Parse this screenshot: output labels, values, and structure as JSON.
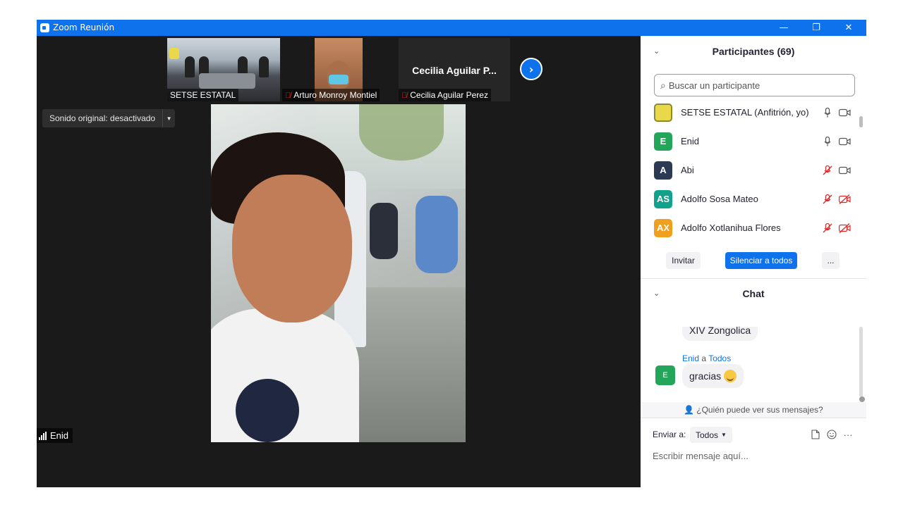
{
  "window": {
    "title": "Zoom Reunión",
    "controls": {
      "minimize": "—",
      "restore": "❐",
      "close": "✕"
    }
  },
  "meeting": {
    "thumbnails": [
      {
        "name": "SETSE ESTATAL",
        "muted": false
      },
      {
        "name": "Arturo Monroy Montiel",
        "muted": true
      },
      {
        "name": "Cecilia Aguilar Perez",
        "muted": true,
        "display_name": "Cecilia  Aguilar  P..."
      }
    ],
    "next_page_icon": "chevron-right-icon",
    "original_sound_label": "Sonido original: desactivado",
    "active_speaker": {
      "name": "Enid"
    }
  },
  "participants": {
    "header": "Participantes (69)",
    "search_placeholder": "Buscar un participante",
    "list": [
      {
        "initials": "",
        "name": "SETSE ESTATAL (Anfitrión, yo)",
        "color": "#e8d84a",
        "mic": "on",
        "video": "on"
      },
      {
        "initials": "E",
        "name": "Enid",
        "color": "#23a55a",
        "mic": "on",
        "video": "on"
      },
      {
        "initials": "A",
        "name": "Abi",
        "color": "#2b3a52",
        "mic": "off",
        "video": "on"
      },
      {
        "initials": "AS",
        "name": "Adolfo Sosa Mateo",
        "color": "#12a28c",
        "mic": "off",
        "video": "off"
      },
      {
        "initials": "AX",
        "name": "Adolfo Xotlanihua Flores",
        "color": "#f0a020",
        "mic": "off",
        "video": "off"
      }
    ],
    "buttons": {
      "invite": "Invitar",
      "mute_all": "Silenciar a todos",
      "more": "..."
    }
  },
  "chat": {
    "header": "Chat",
    "messages": [
      {
        "text": "XIV Zongolica"
      },
      {
        "sender": "Enid",
        "connector": "a",
        "recipient": "Todos",
        "avatar": "E",
        "text": "gracias"
      }
    ],
    "who_can_see": "¿Quién puede ver sus mensajes?",
    "send_to_label": "Enviar a:",
    "send_to_value": "Todos",
    "input_placeholder": "Escribir mensaje aquí...",
    "more": "···"
  },
  "colors": {
    "accent": "#0e72ed",
    "muted_red": "#e02828"
  }
}
